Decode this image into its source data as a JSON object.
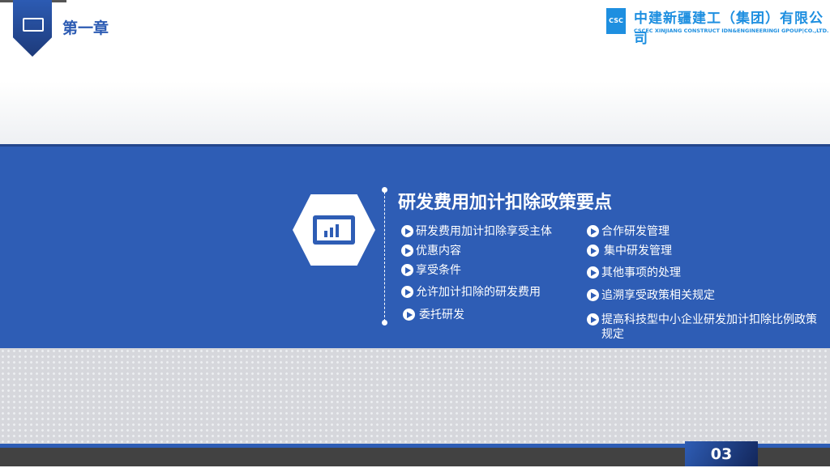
{
  "header": {
    "chapter": "第一章",
    "company_cn": "中建新疆建工（集团）有限公司",
    "company_en": "CSCEC XINJIANG CONSTRUCT IDN&ENGINEERINGI GPOUP|CO.,LTD."
  },
  "main": {
    "title": "研发费用加计扣除政策要点",
    "left_items": [
      "研发费用加计扣除享受主体",
      "优惠内容",
      "享受条件",
      "允许加计扣除的研发费用",
      "委托研发"
    ],
    "right_items": [
      "合作研发管理",
      "集中研发管理",
      "其他事项的处理",
      "追溯享受政策相关规定",
      "提高科技型中小企业研发加计扣除比例政策规定"
    ]
  },
  "footer": {
    "page": "03"
  },
  "colors": {
    "brand": "#2e5db5",
    "logo": "#1e8fe0"
  }
}
